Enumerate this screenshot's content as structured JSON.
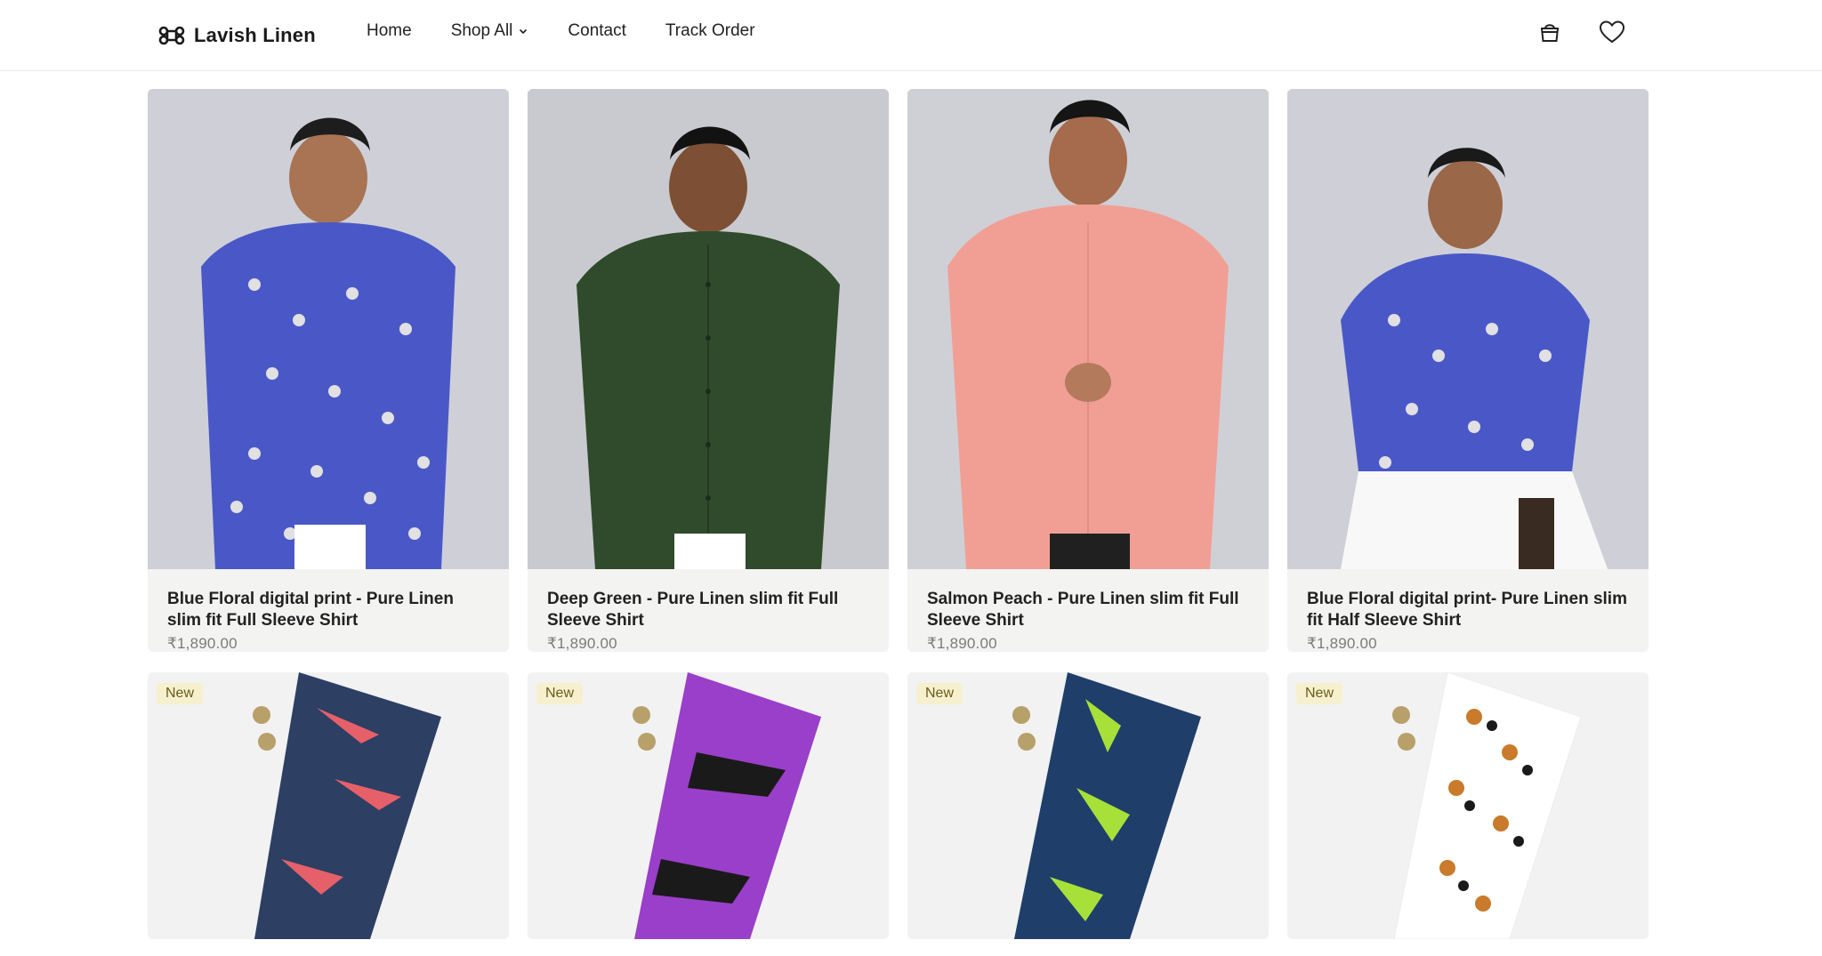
{
  "header": {
    "brand_name": "Lavish Linen",
    "nav": [
      {
        "label": "Home"
      },
      {
        "label": "Shop All"
      },
      {
        "label": "Contact"
      },
      {
        "label": "Track Order"
      }
    ],
    "icons": [
      "command-logo-icon",
      "chevron-down-icon",
      "shopping-bag-icon",
      "heart-icon"
    ]
  },
  "products": [
    {
      "title": "Blue Floral digital print - Pure Linen slim fit Full Sleeve Shirt",
      "price": "₹1,890.00",
      "shirt_color": "#4a58c7",
      "pattern": "floral",
      "sleeve": "full"
    },
    {
      "title": "Deep Green - Pure Linen slim fit Full Sleeve Shirt",
      "price": "₹1,890.00",
      "shirt_color": "#2f4b2c",
      "pattern": "plain",
      "sleeve": "full"
    },
    {
      "title": "Salmon Peach - Pure Linen slim fit Full Sleeve Shirt",
      "price": "₹1,890.00",
      "shirt_color": "#f19f95",
      "pattern": "plain",
      "sleeve": "full"
    },
    {
      "title": "Blue Floral digital print- Pure Linen slim fit Half Sleeve Shirt",
      "price": "₹1,890.00",
      "shirt_color": "#4a58c7",
      "pattern": "floral",
      "sleeve": "half"
    }
  ],
  "fabrics": [
    {
      "badge": "New",
      "base_color": "#2d3f63",
      "accent_color": "#e6606a"
    },
    {
      "badge": "New",
      "base_color": "#9a3fc9",
      "accent_color": "#1a1a1a"
    },
    {
      "badge": "New",
      "base_color": "#1f3f6a",
      "accent_color": "#a8e03a"
    },
    {
      "badge": "New",
      "base_color": "#ffffff",
      "accent_color": "#c97a2a"
    }
  ]
}
